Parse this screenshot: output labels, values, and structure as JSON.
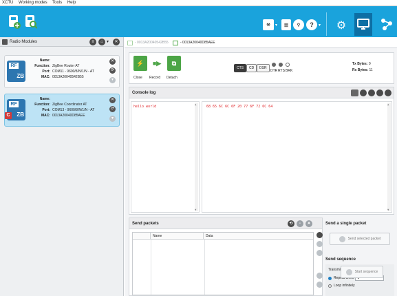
{
  "menu": [
    "XCTU",
    "Working modes",
    "Tools",
    "Help"
  ],
  "left_panel": {
    "title": "Radio Modules",
    "modules": [
      {
        "name_label": "Name:",
        "name_value": "",
        "function_label": "Function:",
        "function_value": "ZigBee Router AT",
        "port_label": "Port:",
        "port_value": "COM11 - 9600/8/N/1/N - AT",
        "mac_label": "MAC:",
        "mac_value": "0013A20040542B55",
        "icon_text": "RF",
        "icon_sub": "ZB"
      },
      {
        "name_label": "Name:",
        "name_value": "",
        "function_label": "Function:",
        "function_value": "ZigBee Coordinator AT",
        "port_label": "Port:",
        "port_value": "COM13 - 9600/8/N/1/N - AT",
        "mac_label": "MAC:",
        "mac_value": "0013A20040D85AEE",
        "icon_text": "RF",
        "icon_sub": "ZB",
        "badge": "C"
      }
    ]
  },
  "tabs": [
    {
      "label": "- 0013A20040542B55",
      "active": false
    },
    {
      "label": "- 0013A20040D85AEE",
      "active": true
    }
  ],
  "controls": {
    "close": "Close",
    "record": "Record",
    "detach": "Detach",
    "cts": "CTS",
    "cd": "CD",
    "dsr": "DSR",
    "dtr": "DTR",
    "rts": "RTS",
    "brk": "BRK",
    "tx_label": "Tx Bytes:",
    "tx_value": "0",
    "rx_label": "Rx Bytes:",
    "rx_value": "11"
  },
  "console": {
    "title": "Console log",
    "ascii_text": "hello world",
    "hex_text": "68 65 6C 6C 6F 20 77 6F 72 6C 64"
  },
  "send_packets": {
    "title": "Send packets",
    "columns": [
      "Name",
      "Data"
    ]
  },
  "single_packet": {
    "title": "Send a single packet",
    "button": "Send selected packet"
  },
  "sequence": {
    "title": "Send sequence",
    "interval_label": "Transmit interval (ms):",
    "interval_value": "500",
    "repeat_label": "Repeat times",
    "repeat_value": "1",
    "loop_label": "Loop infinitely",
    "start_button": "Start sequence"
  },
  "colors": {
    "toolbar": "#1aa3dc",
    "accent_green": "#4ca546",
    "log_red": "#e0262a"
  }
}
